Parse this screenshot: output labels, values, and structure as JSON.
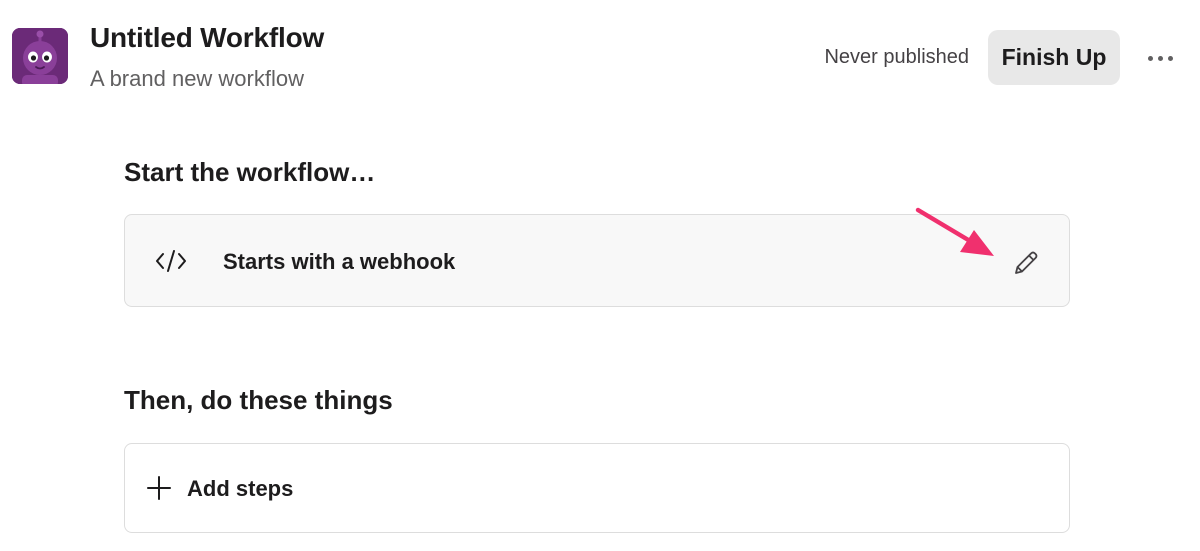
{
  "header": {
    "title": "Untitled Workflow",
    "subtitle": "A brand new workflow",
    "publish_status": "Never published",
    "finish_label": "Finish Up"
  },
  "icons": {
    "avatar": "robot-avatar-icon",
    "more": "more-icon",
    "trigger": "code-icon",
    "edit": "pencil-icon",
    "add": "plus-icon",
    "annotation": "arrow-icon"
  },
  "start_section": {
    "heading": "Start the workflow…",
    "trigger_label": "Starts with a webhook"
  },
  "then_section": {
    "heading": "Then, do these things",
    "add_label": "Add steps"
  },
  "colors": {
    "accent": "#6b2a78",
    "annotation_arrow": "#f0306e",
    "button_bg": "#e8e8e8"
  }
}
